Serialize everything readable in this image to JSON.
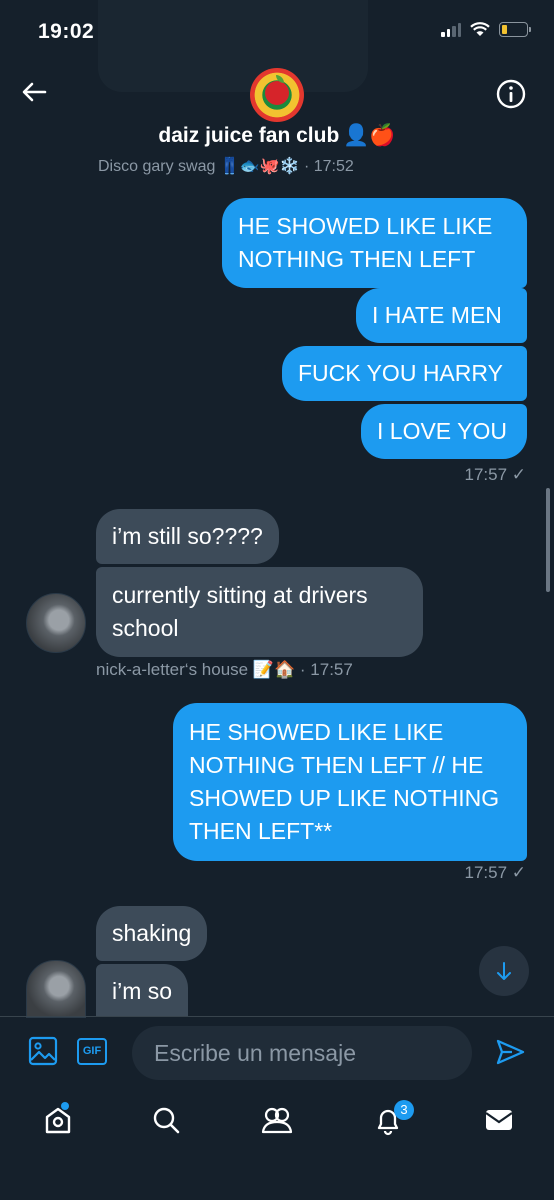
{
  "status_bar": {
    "time": "19:02"
  },
  "header": {
    "title": "daiz juice fan club",
    "title_emoji": "👤🍎",
    "last_meta": "Disco gary swag 👖🐟🐙❄️ · 17:52"
  },
  "messages": {
    "out1": [
      "HE SHOWED LIKE LIKE NOTHING THEN LEFT",
      "I HATE MEN",
      "FUCK YOU HARRY",
      "I LOVE YOU"
    ],
    "out1_meta": "17:57 ✓",
    "in1": [
      "i’m still so????",
      "currently sitting at drivers school"
    ],
    "in1_meta": "nick-a-letter‘s house 📝🏠 · 17:57",
    "out2": "HE SHOWED LIKE LIKE NOTHING THEN LEFT // HE SHOWED UP LIKE NOTHING THEN LEFT**",
    "out2_meta": "17:57 ✓",
    "in2": [
      "shaking",
      "i’m so"
    ]
  },
  "composer": {
    "placeholder": "Escribe un mensaje",
    "gif_label": "GIF"
  },
  "nav": {
    "notifications_badge": "3"
  },
  "colors": {
    "background": "#15202b",
    "accent": "#1d9bf0",
    "incoming": "#3d4b59"
  }
}
